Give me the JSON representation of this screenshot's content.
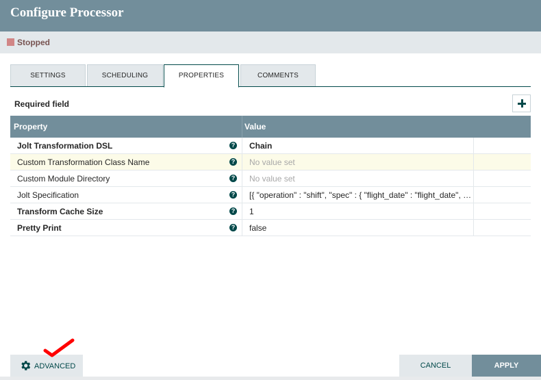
{
  "dialog": {
    "title": "Configure Processor"
  },
  "status": {
    "text": "Stopped",
    "color": "#d18686"
  },
  "tabs": [
    {
      "label": "SETTINGS",
      "active": false
    },
    {
      "label": "SCHEDULING",
      "active": false
    },
    {
      "label": "PROPERTIES",
      "active": true
    },
    {
      "label": "COMMENTS",
      "active": false
    }
  ],
  "properties": {
    "required_label": "Required field",
    "add_icon": "plus-icon",
    "columns": [
      "Property",
      "Value"
    ],
    "rows": [
      {
        "name": "Jolt Transformation DSL",
        "required": true,
        "value": "Chain",
        "empty": false
      },
      {
        "name": "Custom Transformation Class Name",
        "required": false,
        "value": "No value set",
        "empty": true
      },
      {
        "name": "Custom Module Directory",
        "required": false,
        "value": "No value set",
        "empty": true
      },
      {
        "name": "Jolt Specification",
        "required": false,
        "value": "[{ \"operation\" : \"shift\", \"spec\" : { \"flight_date\" : \"flight_date\", \"flight_number\" : \"flight_number\"",
        "empty": false
      },
      {
        "name": "Transform Cache Size",
        "required": true,
        "value": "1",
        "empty": false
      },
      {
        "name": "Pretty Print",
        "required": true,
        "value": "false",
        "empty": false
      }
    ]
  },
  "footer": {
    "advanced_label": "ADVANCED",
    "cancel_label": "CANCEL",
    "apply_label": "APPLY"
  },
  "colors": {
    "header": "#728e9b",
    "accent": "#004849",
    "annotation": "#ff0000"
  }
}
